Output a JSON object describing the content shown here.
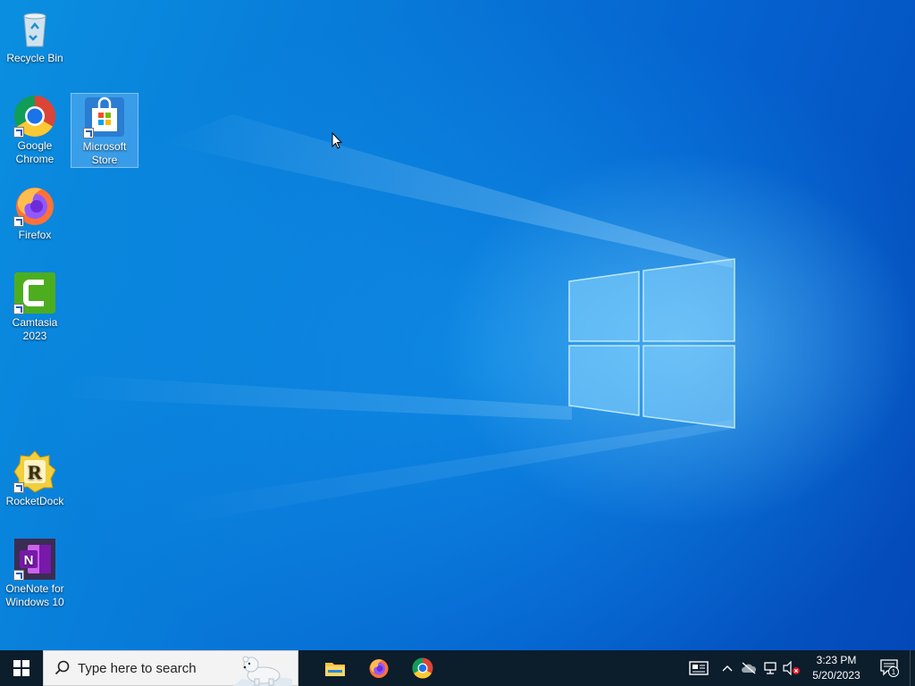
{
  "desktop": {
    "icons": [
      {
        "label": "Recycle Bin",
        "icon": "recycle-bin-icon"
      },
      {
        "label": "Google Chrome",
        "icon": "chrome-icon"
      },
      {
        "label": "Microsoft Store",
        "icon": "microsoft-store-icon",
        "selected": true
      },
      {
        "label": "Firefox",
        "icon": "firefox-icon"
      },
      {
        "label": "Camtasia 2023",
        "icon": "camtasia-icon"
      },
      {
        "label": "RocketDock",
        "icon": "rocketdock-icon"
      },
      {
        "label": "OneNote for Windows 10",
        "icon": "onenote-icon"
      }
    ]
  },
  "taskbar": {
    "search_placeholder": "Type here to search",
    "pinned": [
      "file-explorer-icon",
      "firefox-icon",
      "chrome-icon"
    ],
    "clock": {
      "time": "3:23 PM",
      "date": "5/20/2023"
    },
    "notification_count": "1",
    "tray_icons": [
      "news-widget-icon",
      "chevron-up-icon",
      "cloud-offline-icon",
      "network-icon",
      "volume-muted-icon"
    ]
  },
  "colors": {
    "accent": "#0078d7",
    "taskbar": "#0c1d2c"
  }
}
